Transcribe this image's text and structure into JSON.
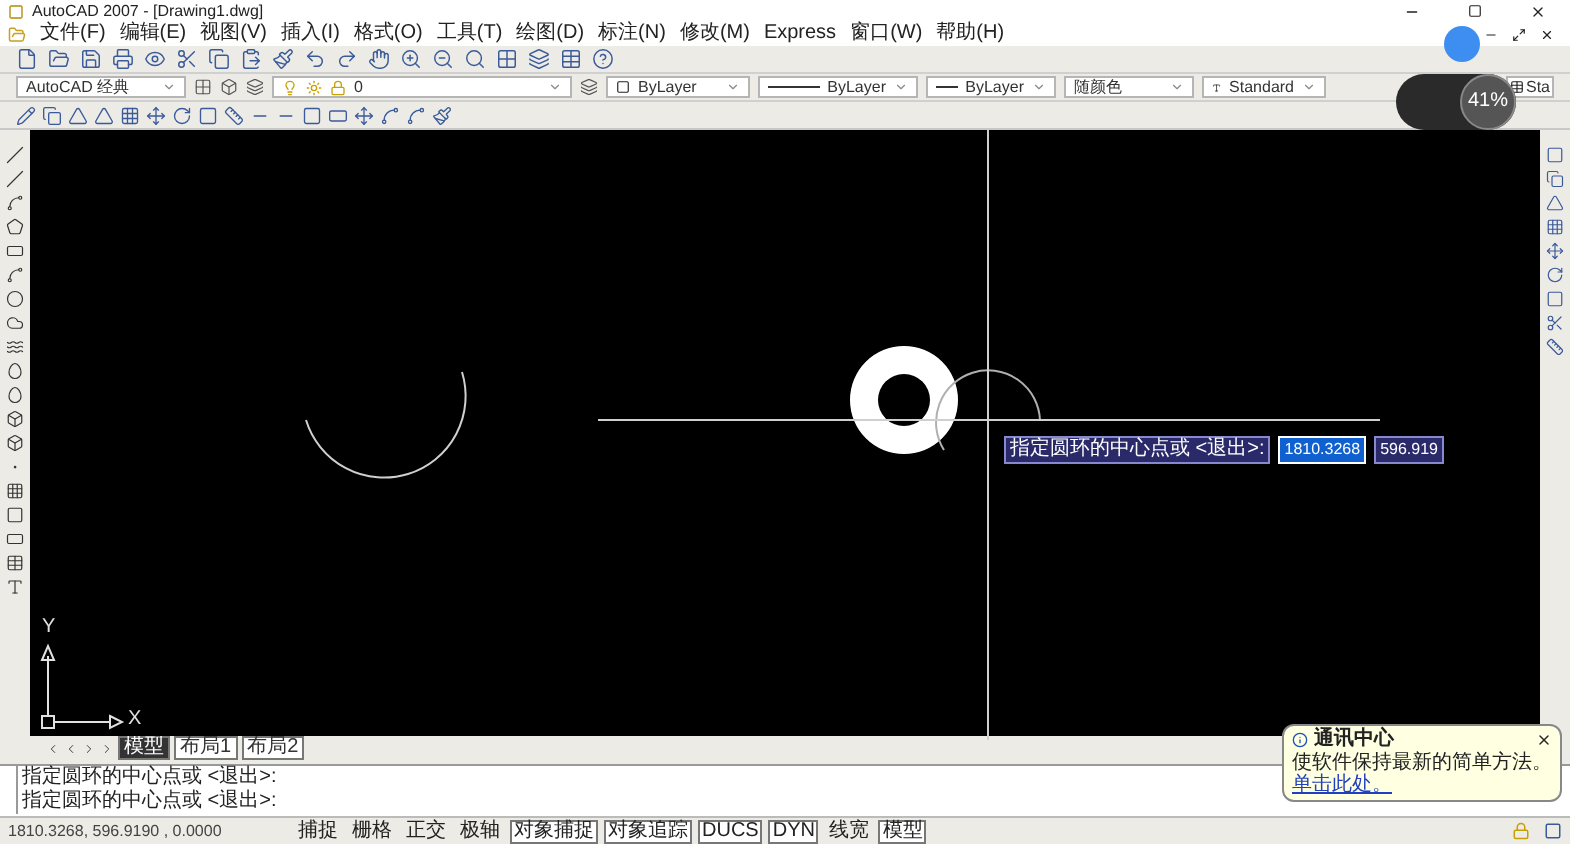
{
  "window": {
    "title": "AutoCAD 2007 - [Drawing1.dwg]"
  },
  "menu": [
    "文件(F)",
    "编辑(E)",
    "视图(V)",
    "插入(I)",
    "格式(O)",
    "工具(T)",
    "绘图(D)",
    "标注(N)",
    "修改(M)",
    "Express",
    "窗口(W)",
    "帮助(H)"
  ],
  "properties_bar": {
    "workspace": "AutoCAD 经典",
    "layer": "0",
    "color_control": "ByLayer",
    "linetype": "ByLayer",
    "lineweight": "ByLayer",
    "plot_style": "随颜色",
    "text_style": "Standard",
    "table_style": "Sta"
  },
  "overlay_meter": {
    "reading": "41%"
  },
  "drawing": {
    "ucs_y": "Y",
    "ucs_x": "X",
    "prompt": "指定圆环的中心点或 <退出>:",
    "x_input": "1810.3268",
    "y_input": "596.919"
  },
  "layout_tabs": [
    {
      "label": "模型",
      "selected": true
    },
    {
      "label": "布局1",
      "selected": false
    },
    {
      "label": "布局2",
      "selected": false
    }
  ],
  "command_lines": [
    "指定圆环的中心点或 <退出>:",
    "指定圆环的中心点或 <退出>:"
  ],
  "status_bar": {
    "coordinates": "1810.3268, 596.9190 , 0.0000",
    "toggles": [
      {
        "label": "捕捉",
        "on": false
      },
      {
        "label": "栅格",
        "on": false
      },
      {
        "label": "正交",
        "on": false
      },
      {
        "label": "极轴",
        "on": false
      },
      {
        "label": "对象捕捉",
        "on": true
      },
      {
        "label": "对象追踪",
        "on": true
      },
      {
        "label": "DUCS",
        "on": true
      },
      {
        "label": "DYN",
        "on": true
      },
      {
        "label": "线宽",
        "on": false
      },
      {
        "label": "模型",
        "on": true
      }
    ]
  },
  "balloon": {
    "title": "通讯中心",
    "text": "使软件保持最新的简单方法。",
    "link": "单击此处。"
  }
}
